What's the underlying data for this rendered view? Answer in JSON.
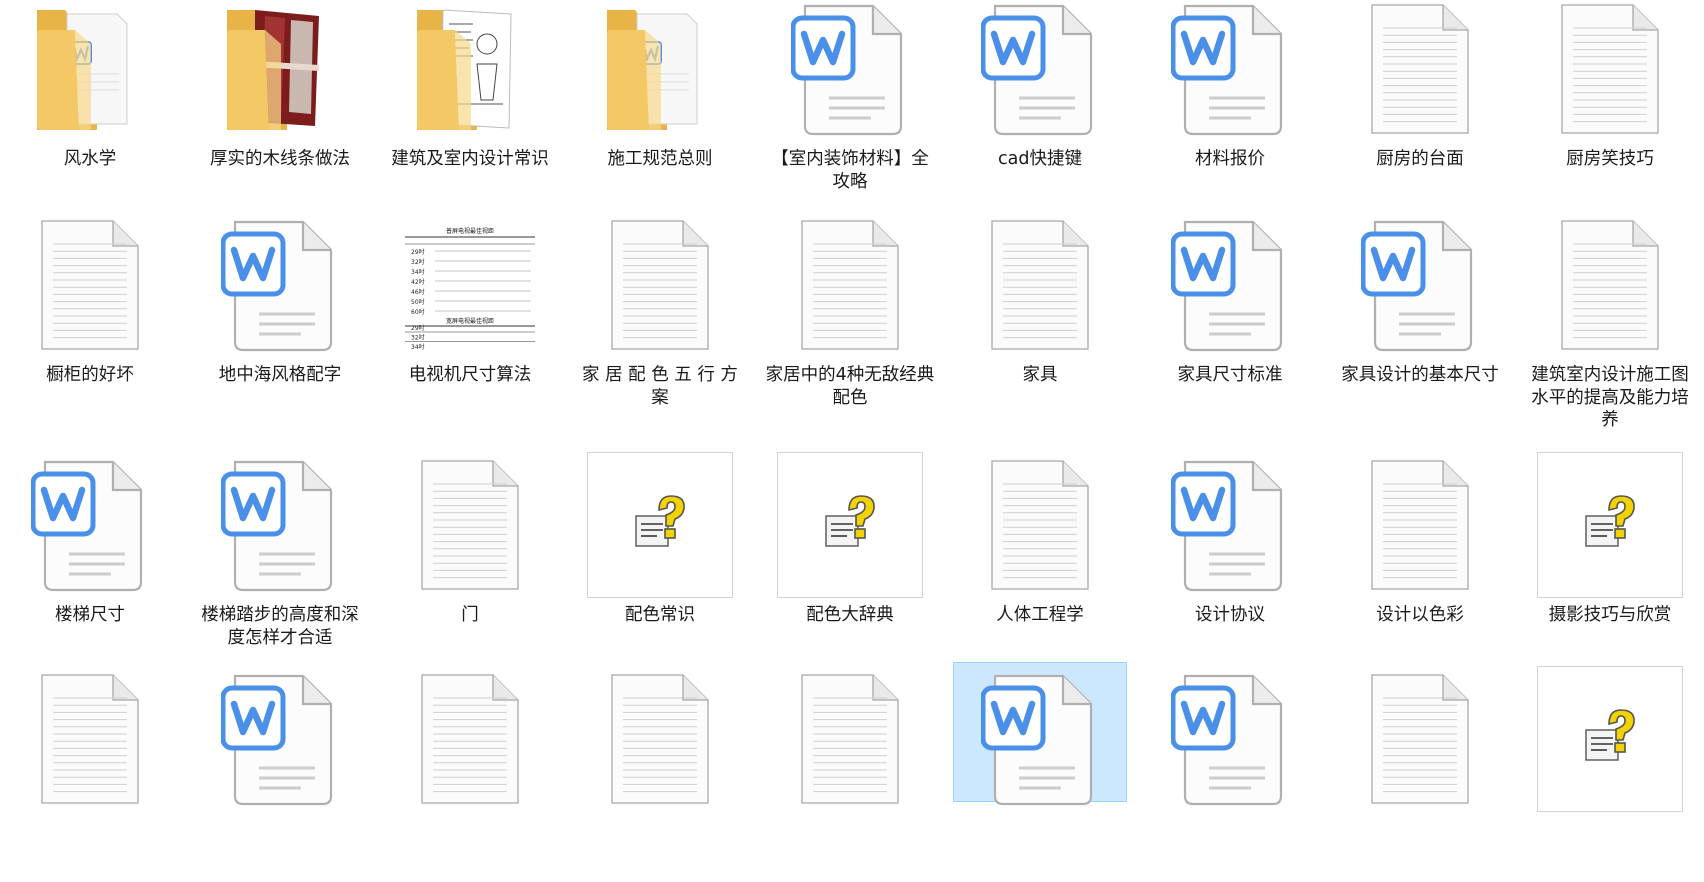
{
  "colors": {
    "selection": "#cce8ff",
    "wps_blue": "#4a8fe8",
    "folder_yellow": "#f5c866",
    "help_yellow": "#f2d200"
  },
  "files": [
    {
      "name": "风水学",
      "icon": "folder-icon",
      "preview": "word-doc"
    },
    {
      "name": "厚实的木线条做法",
      "icon": "folder-icon",
      "preview": "wood-photo"
    },
    {
      "name": "建筑及室内设计常识",
      "icon": "folder-icon",
      "preview": "sketch-page"
    },
    {
      "name": "施工规范总则",
      "icon": "folder-icon",
      "preview": "word-doc"
    },
    {
      "name": "【室内装饰材料】全攻略",
      "icon": "wps-document-icon"
    },
    {
      "name": "cad快捷键",
      "icon": "wps-document-icon"
    },
    {
      "name": "材料报价",
      "icon": "wps-document-icon"
    },
    {
      "name": "厨房的台面",
      "icon": "text-document-icon"
    },
    {
      "name": "厨房笑技巧",
      "icon": "text-document-icon"
    },
    {
      "name": "橱柜的好坏",
      "icon": "text-document-icon"
    },
    {
      "name": "地中海风格配字",
      "icon": "wps-document-icon"
    },
    {
      "name": "电视机尺寸算法",
      "icon": "table-thumbnail-icon"
    },
    {
      "name": "家 居 配 色 五 行 方 案",
      "icon": "text-document-icon"
    },
    {
      "name": "家居中的4种无敌经典配色",
      "icon": "text-document-icon"
    },
    {
      "name": "家具",
      "icon": "text-document-icon"
    },
    {
      "name": "家具尺寸标准",
      "icon": "wps-document-icon"
    },
    {
      "name": "家具设计的基本尺寸",
      "icon": "wps-document-icon"
    },
    {
      "name": "建筑室内设计施工图水平的提高及能力培养",
      "icon": "text-document-icon"
    },
    {
      "name": "楼梯尺寸",
      "icon": "wps-document-icon"
    },
    {
      "name": "楼梯踏步的高度和深度怎样才合适",
      "icon": "wps-document-icon"
    },
    {
      "name": "门",
      "icon": "text-document-icon"
    },
    {
      "name": "配色常识",
      "icon": "help-file-icon"
    },
    {
      "name": "配色大辞典",
      "icon": "help-file-icon"
    },
    {
      "name": "人体工程学",
      "icon": "text-document-icon"
    },
    {
      "name": "设计协议",
      "icon": "wps-document-icon"
    },
    {
      "name": "设计以色彩",
      "icon": "text-document-icon"
    },
    {
      "name": "摄影技巧与欣赏",
      "icon": "help-file-icon"
    },
    {
      "name": "",
      "icon": "text-document-icon"
    },
    {
      "name": "",
      "icon": "wps-document-icon"
    },
    {
      "name": "",
      "icon": "text-document-icon"
    },
    {
      "name": "",
      "icon": "text-document-icon"
    },
    {
      "name": "",
      "icon": "text-document-icon"
    },
    {
      "name": "",
      "icon": "wps-document-icon",
      "selected": true
    },
    {
      "name": "",
      "icon": "wps-document-icon"
    },
    {
      "name": "",
      "icon": "text-document-icon"
    },
    {
      "name": "",
      "icon": "help-file-icon"
    }
  ],
  "tv_table": {
    "title1": "普屏电视最佳视距",
    "title2": "宽屏电视最佳视距",
    "rows": [
      "29吋",
      "32吋",
      "34吋",
      "42吋",
      "46吋",
      "50吋",
      "60吋"
    ]
  }
}
